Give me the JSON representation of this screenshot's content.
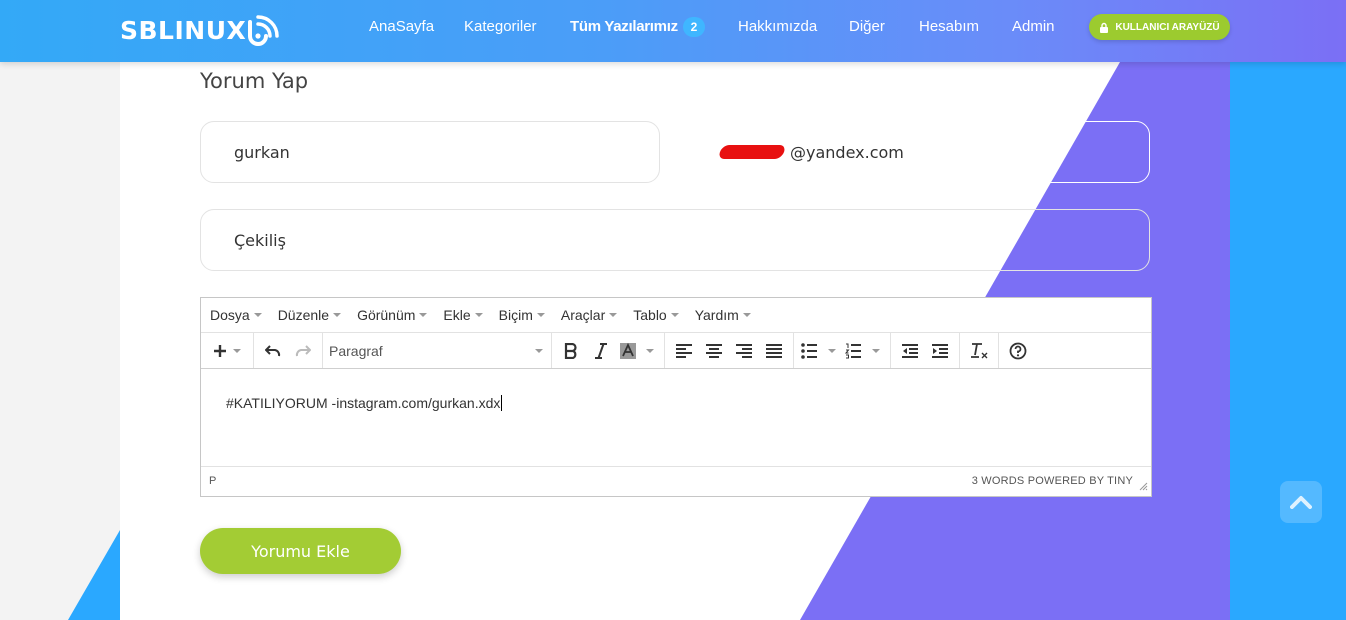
{
  "navbar": {
    "logo_text": "SBLINUX",
    "items": [
      {
        "label": "AnaSayfa"
      },
      {
        "label": "Kategoriler"
      },
      {
        "label": "Tüm Yazılarımız",
        "badge": "2"
      },
      {
        "label": "Hakkımızda"
      },
      {
        "label": "Diğer"
      },
      {
        "label": "Hesabım"
      },
      {
        "label": "Admin"
      }
    ],
    "user_button": "KULLANICI ARAYÜZÜ"
  },
  "form": {
    "heading": "Yorum Yap",
    "name_value": "gurkan",
    "email_value": "@yandex.com",
    "subject_value": "Çekiliş"
  },
  "editor": {
    "menu": [
      "Dosya",
      "Düzenle",
      "Görünüm",
      "Ekle",
      "Biçim",
      "Araçlar",
      "Tablo",
      "Yardım"
    ],
    "format_select": "Paragraf",
    "content": "#KATILIYORUM -instagram.com/gurkan.xdx",
    "status_path": "P",
    "status_right": "3 WORDS POWERED BY TINY"
  },
  "submit_label": "Yorumu Ekle",
  "colors": {
    "nav_start": "#33a9f7",
    "nav_end": "#7b6ff5",
    "accent_green": "#a3cc34",
    "purple": "#7b6ff5",
    "blue": "#2aa8ff"
  }
}
